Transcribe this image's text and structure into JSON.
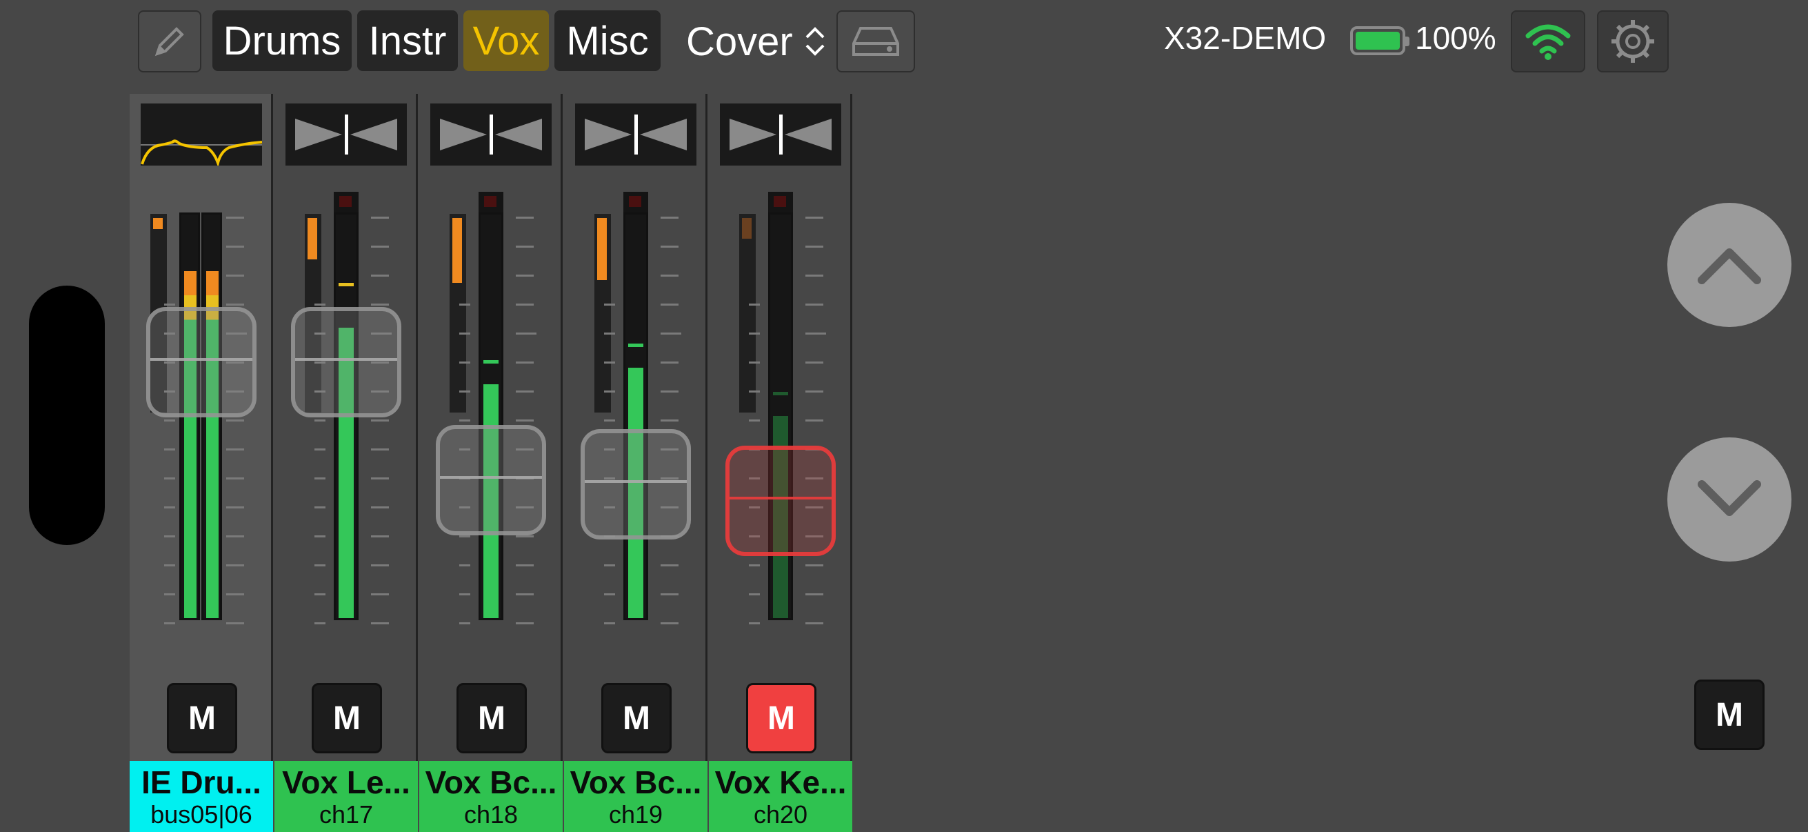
{
  "toolbar": {
    "edit_icon": "pencil-icon",
    "groups": [
      {
        "label": "Drums",
        "active": false
      },
      {
        "label": "Instr",
        "active": false
      },
      {
        "label": "Vox",
        "active": true
      },
      {
        "label": "Misc",
        "active": false
      }
    ],
    "scene": "Cover",
    "scene_icon": "up-down-chevron-icon",
    "drive_icon": "hard-drive-icon",
    "device": "X32-DEMO",
    "battery_pct": "100%",
    "battery_level": 1.0,
    "wifi_icon": "wifi-icon",
    "settings_icon": "gear-icon"
  },
  "channels": [
    {
      "name": "IE Dru...",
      "id": "bus05|06",
      "mute_label": "M",
      "muted": false,
      "kind": "bus",
      "top_display": "eq-curve",
      "fader_level": 0.87,
      "meter_level": 0.86
    },
    {
      "name": "Vox Le...",
      "id": "ch17",
      "mute_label": "M",
      "muted": false,
      "kind": "channel",
      "top_display": "pan",
      "fader_level": 0.87,
      "meter_level": 0.72
    },
    {
      "name": "Vox Bc...",
      "id": "ch18",
      "mute_label": "M",
      "muted": false,
      "kind": "channel",
      "top_display": "pan",
      "fader_level": 0.58,
      "meter_level": 0.58
    },
    {
      "name": "Vox Bc...",
      "id": "ch19",
      "mute_label": "M",
      "muted": false,
      "kind": "channel",
      "top_display": "pan",
      "fader_level": 0.57,
      "meter_level": 0.62
    },
    {
      "name": "Vox Ke...",
      "id": "ch20",
      "mute_label": "M",
      "muted": true,
      "kind": "channel",
      "top_display": "pan",
      "fader_level": 0.53,
      "meter_level": 0.5
    }
  ],
  "nav": {
    "up_icon": "chevron-up-icon",
    "down_icon": "chevron-down-icon"
  },
  "master": {
    "mute_label": "M"
  },
  "colors": {
    "bus": "#00f0f0",
    "channel": "#2fc250",
    "active_tab": "#f5c400",
    "mute_on": "#f04040"
  }
}
